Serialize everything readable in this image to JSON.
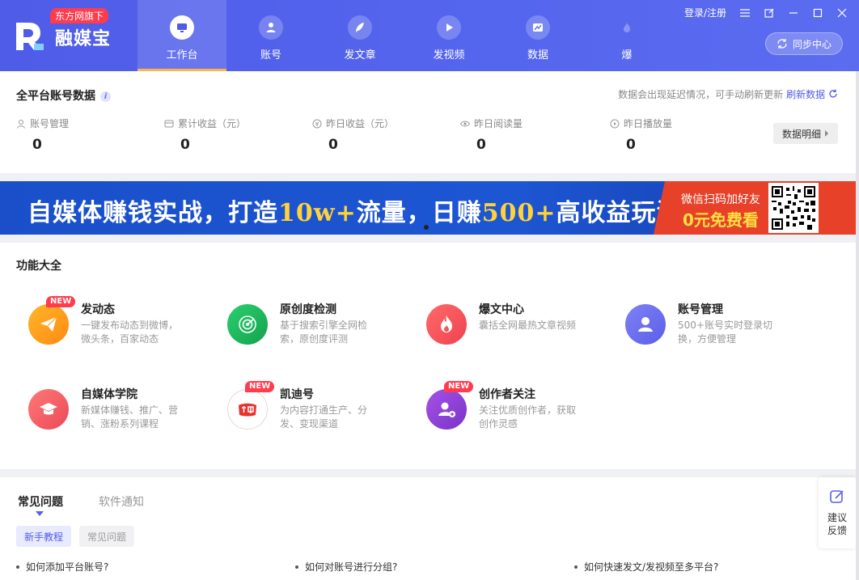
{
  "header": {
    "badge": "东方网旗下",
    "app_name": "融媒宝",
    "login": "登录/注册",
    "sync": "同步中心",
    "nav": [
      {
        "label": "工作台",
        "icon": "monitor-icon",
        "active": true
      },
      {
        "label": "账号",
        "icon": "user-icon",
        "active": false
      },
      {
        "label": "发文章",
        "icon": "feather-icon",
        "active": false
      },
      {
        "label": "发视频",
        "icon": "play-icon",
        "active": false
      },
      {
        "label": "数据",
        "icon": "chart-icon",
        "active": false
      },
      {
        "label": "爆",
        "icon": "fire-icon",
        "active": false
      }
    ]
  },
  "stats": {
    "title": "全平台账号数据",
    "note": "数据会出现延迟情况，可手动刷新更新",
    "refresh": "刷新数据",
    "detail": "数据明细",
    "items": [
      {
        "label": "账号管理",
        "value": "0"
      },
      {
        "label": "累计收益（元）",
        "value": "0"
      },
      {
        "label": "昨日收益（元）",
        "value": "0"
      },
      {
        "label": "昨日阅读量",
        "value": "0"
      },
      {
        "label": "昨日播放量",
        "value": "0"
      }
    ]
  },
  "banner": {
    "part1": "自媒体赚钱实战，打造",
    "hl1": "10w+",
    "part2": "流量，日赚",
    "hl2": "500+",
    "part3": "高收益玩法",
    "right_line1": "微信扫码加好友",
    "right_line2": "0元免费看"
  },
  "features": {
    "title": "功能大全",
    "items": [
      {
        "title": "发动态",
        "desc": "一键发布动态到微博，微头条，百家动态",
        "new": "NEW",
        "color": "#ff9a1f"
      },
      {
        "title": "原创度检测",
        "desc": "基于搜索引擎全网检索，原创度评测",
        "new": "",
        "color": "#1fb85f"
      },
      {
        "title": "爆文中心",
        "desc": "囊括全网最热文章视频",
        "new": "",
        "color": "#f2545b"
      },
      {
        "title": "账号管理",
        "desc": "500+账号实时登录切换，方便管理",
        "new": "",
        "color": "#6a6df0"
      },
      {
        "title": "自媒体学院",
        "desc": "新媒体赚钱、推广、营销、涨粉系列课程",
        "new": "",
        "color": "#ef5a63"
      },
      {
        "title": "凯迪号",
        "desc": "为内容打通生产、分发、变现渠道",
        "new": "NEW",
        "color": "#e8322e"
      },
      {
        "title": "创作者关注",
        "desc": "关注优质创作者，获取创作灵感",
        "new": "NEW",
        "color": "#8a3fd6"
      }
    ]
  },
  "faq": {
    "tabs": [
      "常见问题",
      "软件通知"
    ],
    "subtabs": [
      "新手教程",
      "常见问题"
    ],
    "items": [
      "如何添加平台账号?",
      "如何对账号进行分组?",
      "如何快速发文/发视频至多平台?"
    ]
  },
  "feedback": {
    "line1": "建议",
    "line2": "反馈"
  }
}
